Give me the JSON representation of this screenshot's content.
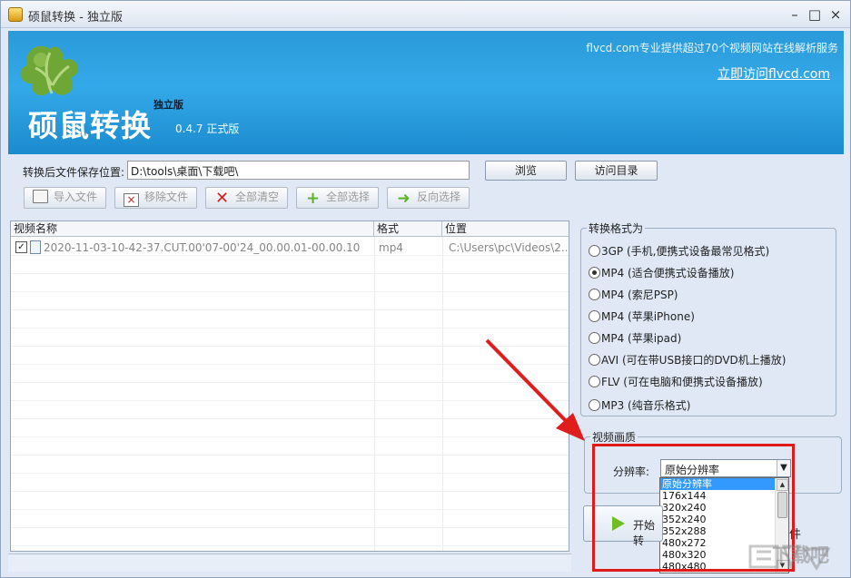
{
  "window": {
    "title": "硕鼠转换 - 独立版"
  },
  "banner": {
    "service_text": "flvcd.com专业提供超过70个视频网站在线解析服务",
    "visit_link": "立即访问flvcd.com",
    "app_name": "硕鼠转换",
    "edition": "独立版",
    "version": "0.4.7 正式版"
  },
  "save": {
    "label": "转换后文件保存位置:",
    "value": "D:\\tools\\桌面\\下载吧\\",
    "browse": "浏览",
    "visit_dir": "访问目录"
  },
  "toolbar": {
    "import": "导入文件",
    "remove": "移除文件",
    "clear": "全部清空",
    "select_all": "全部选择",
    "invert": "反向选择"
  },
  "table": {
    "headers": [
      "视频名称",
      "格式",
      "位置"
    ],
    "rows": [
      {
        "name": "2020-11-03-10-42-37.CUT.00'07-00'24_00.00.01-00.00.10",
        "format": "mp4",
        "location": "C:\\Users\\pc\\Videos\\2..."
      }
    ]
  },
  "format_group": {
    "title": "转换格式为",
    "options": [
      "3GP (手机,便携式设备最常见格式)",
      "MP4 (适合便携式设备播放)",
      "MP4 (索尼PSP)",
      "MP4 (苹果iPhone)",
      "MP4 (苹果ipad)",
      "AVI (可在带USB接口的DVD机上播放)",
      "FLV (可在电脑和便携式设备播放)",
      "MP3 (纯音乐格式)"
    ],
    "selected": "MP4 (适合便携式设备播放)"
  },
  "quality": {
    "title": "视频画质",
    "label": "分辨率:",
    "selected": "原始分辨率",
    "options": [
      "原始分辨率",
      "176x144",
      "320x240",
      "352x240",
      "352x288",
      "480x272",
      "480x320",
      "480x480"
    ]
  },
  "actions": {
    "start": "开始转",
    "partial": "件"
  },
  "watermark": {
    "text": "下载吧"
  },
  "colors": {
    "banner": "#2a9ad9",
    "highlight": "#e01919",
    "selection": "#3399ff"
  }
}
